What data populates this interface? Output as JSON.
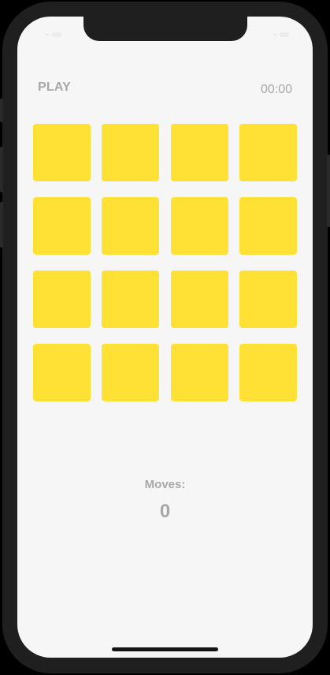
{
  "header": {
    "play_label": "PLAY",
    "timer": "00:00"
  },
  "board": {
    "rows": 4,
    "columns": 4,
    "card_color": "#ffe135",
    "cards": [
      {
        "state": "face-down"
      },
      {
        "state": "face-down"
      },
      {
        "state": "face-down"
      },
      {
        "state": "face-down"
      },
      {
        "state": "face-down"
      },
      {
        "state": "face-down"
      },
      {
        "state": "face-down"
      },
      {
        "state": "face-down"
      },
      {
        "state": "face-down"
      },
      {
        "state": "face-down"
      },
      {
        "state": "face-down"
      },
      {
        "state": "face-down"
      },
      {
        "state": "face-down"
      },
      {
        "state": "face-down"
      },
      {
        "state": "face-down"
      },
      {
        "state": "face-down"
      }
    ]
  },
  "moves": {
    "label": "Moves:",
    "value": "0"
  },
  "colors": {
    "background": "#f6f6f6",
    "text_muted": "#a8a8a8",
    "frame": "#1f1f1f"
  }
}
